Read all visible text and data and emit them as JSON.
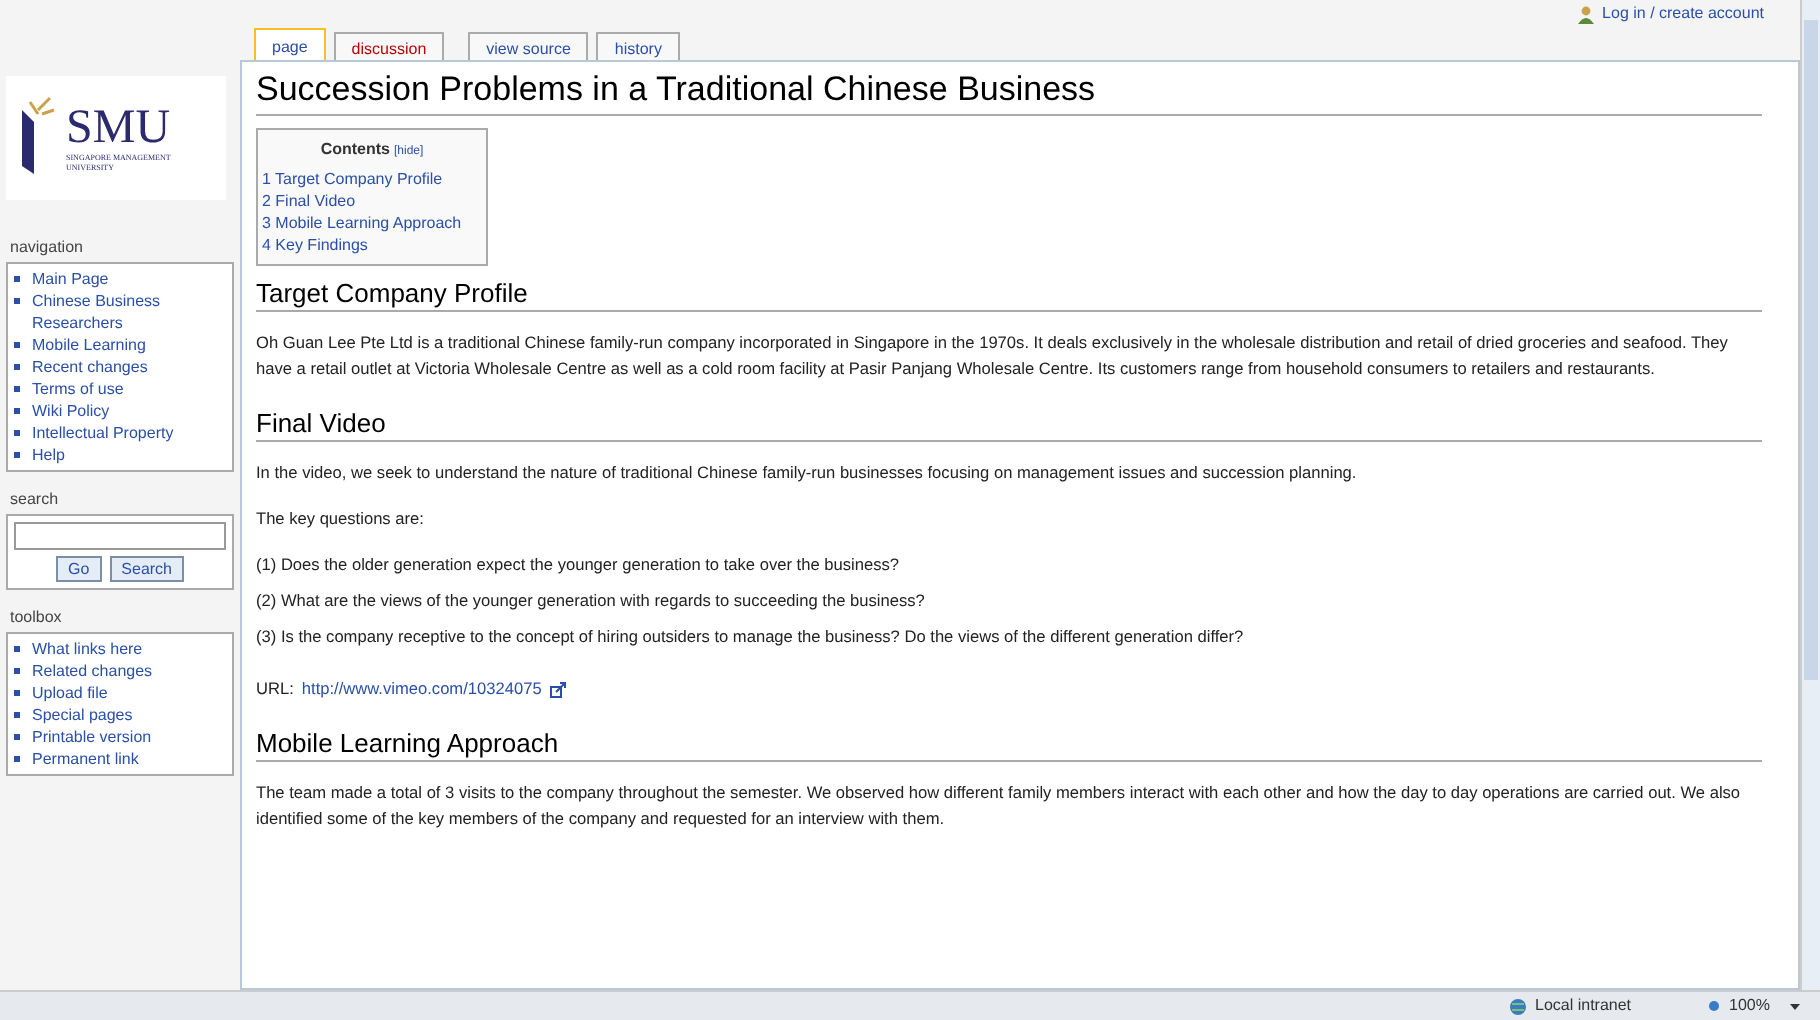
{
  "personal": {
    "login": "Log in / create account"
  },
  "tabs": [
    {
      "label": "page",
      "selected": true,
      "missing": false
    },
    {
      "label": "discussion",
      "selected": false,
      "missing": true
    },
    {
      "label": "view source",
      "selected": false,
      "missing": false
    },
    {
      "label": "history",
      "selected": false,
      "missing": false
    }
  ],
  "logo": {
    "name": "SMU",
    "subtitle": "SINGAPORE MANAGEMENT UNIVERSITY"
  },
  "sidebar": [
    {
      "kind": "links",
      "title": "navigation",
      "items": [
        "Main Page",
        "Chinese Business Researchers",
        "Mobile Learning",
        "Recent changes",
        "Terms of use",
        "Wiki Policy",
        "Intellectual Property",
        "Help"
      ]
    },
    {
      "kind": "search",
      "title": "search",
      "buttons": [
        "Go",
        "Search"
      ]
    },
    {
      "kind": "links",
      "title": "toolbox",
      "items": [
        "What links here",
        "Related changes",
        "Upload file",
        "Special pages",
        "Printable version",
        "Permanent link"
      ]
    }
  ],
  "title": "Succession Problems in a Traditional Chinese Business",
  "toc": {
    "title": "Contents",
    "toggle": "[hide]",
    "items": [
      "1 Target Company Profile",
      "2 Final Video",
      "3 Mobile Learning Approach",
      "4 Key Findings"
    ]
  },
  "sections": [
    {
      "heading": "Target Company Profile",
      "blocks": [
        {
          "kind": "para",
          "text": "Oh Guan Lee Pte Ltd is a traditional Chinese family-run company incorporated in Singapore in the 1970s. It deals exclusively in the wholesale distribution and retail of dried groceries and seafood. They have a retail outlet at Victoria Wholesale Centre as well as a cold room facility at Pasir Panjang Wholesale Centre. Its customers range from household consumers to retailers and restaurants."
        }
      ]
    },
    {
      "heading": "Final Video",
      "blocks": [
        {
          "kind": "para",
          "text": "In the video, we seek to understand the nature of traditional Chinese family-run businesses focusing on management issues and succession planning."
        },
        {
          "kind": "para",
          "text": "The key questions are:"
        },
        {
          "kind": "line",
          "text": "(1) Does the older generation expect the younger generation to take over the business?"
        },
        {
          "kind": "line",
          "text": "(2) What are the views of the younger generation with regards to succeeding the business?"
        },
        {
          "kind": "line",
          "text": "(3) Is the company receptive to the concept of hiring outsiders to manage the business? Do the views of the different generation differ?"
        },
        {
          "kind": "url",
          "label": "URL:",
          "link": "http://www.vimeo.com/10324075"
        }
      ]
    },
    {
      "heading": "Mobile Learning Approach",
      "blocks": [
        {
          "kind": "para",
          "text": "The team made a total of 3 visits to the company throughout the semester. We observed how different family members interact with each other and how the day to day operations are carried out. We also identified some of the key members of the company and requested for an interview with them."
        }
      ]
    }
  ],
  "status_bar": {
    "zone": "Local intranet",
    "zoom": "100%"
  }
}
